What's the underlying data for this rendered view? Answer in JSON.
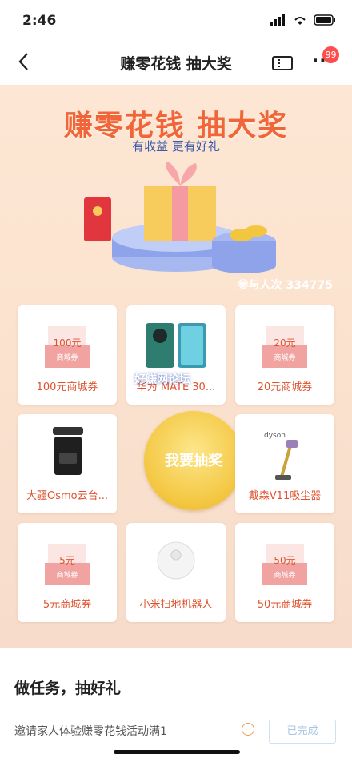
{
  "status": {
    "time": "2:46"
  },
  "nav": {
    "title": "赚零花钱 抽大奖",
    "badge": "99"
  },
  "banner": {
    "title": "赚零花钱 抽大奖",
    "subtitle": "有收益 更有好礼",
    "participants": "参与人次 334775"
  },
  "prizes": [
    {
      "label": "100元商城券",
      "coupon_amt": "100元",
      "coupon_kind": "商城券"
    },
    {
      "label": "华为 MATE 30..."
    },
    {
      "label": "20元商城券",
      "coupon_amt": "20元",
      "coupon_kind": "商城券"
    },
    {
      "label": "大疆Osmo云台..."
    },
    {
      "label": "戴森V11吸尘器",
      "brand": "dyson"
    },
    {
      "label": "5元商城券",
      "coupon_amt": "5元",
      "coupon_kind": "商城券"
    },
    {
      "label": "小米扫地机器人"
    },
    {
      "label": "50元商城券",
      "coupon_amt": "50元",
      "coupon_kind": "商城券"
    }
  ],
  "draw_button": "我要抽奖",
  "watermark": "好赚网论坛",
  "section": {
    "title": "做任务，抽好礼",
    "task": "邀请家人体验赚零花钱活动满1",
    "task_button": "已完成"
  },
  "colors": {
    "accent": "#f0663a",
    "gold": "#f3c63f",
    "banner_bg": "#fde7d4"
  }
}
